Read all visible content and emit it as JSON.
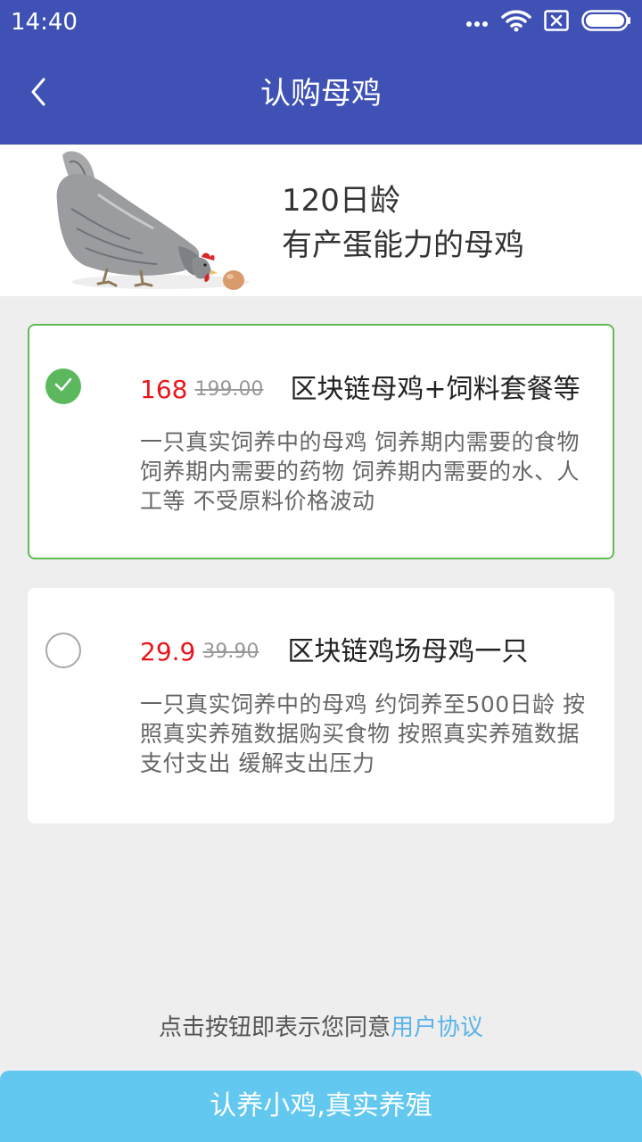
{
  "status_bar": {
    "time": "14:40",
    "icons": [
      "signal-dots-icon",
      "wifi-icon",
      "sim-error-icon",
      "battery-icon"
    ]
  },
  "header": {
    "title": "认购母鸡",
    "back_icon": "back-arrow-icon"
  },
  "hero": {
    "line1": "120日龄",
    "line2": "有产蛋能力的母鸡"
  },
  "packages": [
    {
      "selected": true,
      "price": "168",
      "original_price": "199.00",
      "name": "区块链母鸡+饲料套餐等",
      "description": "一只真实饲养中的母鸡 饲养期内需要的食物 饲养期内需要的药物 饲养期内需要的水、人工等 不受原料价格波动"
    },
    {
      "selected": false,
      "price": "29.9",
      "original_price": "39.90",
      "name": "区块链鸡场母鸡一只",
      "description": "一只真实饲养中的母鸡 约饲养至500日龄 按照真实养殖数据购买食物 按照真实养殖数据支付支出 缓解支出压力"
    }
  ],
  "agreement": {
    "text": "点击按钮即表示您同意",
    "link": "用户协议"
  },
  "submit_button": "认养小鸡,真实养殖",
  "colors": {
    "primary": "#3f51b5",
    "selected_border": "#62bb57",
    "price_red": "#e8161c",
    "button_blue": "#63c8f0",
    "link_blue": "#5ab4e8"
  }
}
